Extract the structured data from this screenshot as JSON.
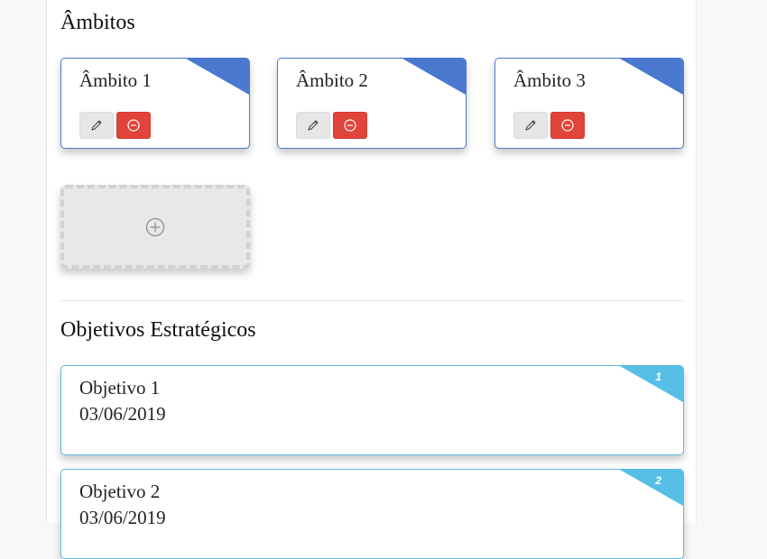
{
  "ambitos": {
    "title": "Âmbitos",
    "items": [
      {
        "label": "Âmbito 1"
      },
      {
        "label": "Âmbito 2"
      },
      {
        "label": "Âmbito 3"
      }
    ],
    "edit_icon": "pencil-icon",
    "remove_icon": "minus-circle-icon",
    "add_icon": "plus-circle-icon"
  },
  "objetivos": {
    "title": "Objetivos Estratégicos",
    "items": [
      {
        "label": "Objetivo 1",
        "date": "03/06/2019",
        "number": "1"
      },
      {
        "label": "Objetivo 2",
        "date": "03/06/2019",
        "number": "2"
      }
    ]
  },
  "colors": {
    "ambito_accent": "#4a79cf",
    "objetivo_accent": "#56bfe6",
    "remove_button": "#e0443a"
  }
}
